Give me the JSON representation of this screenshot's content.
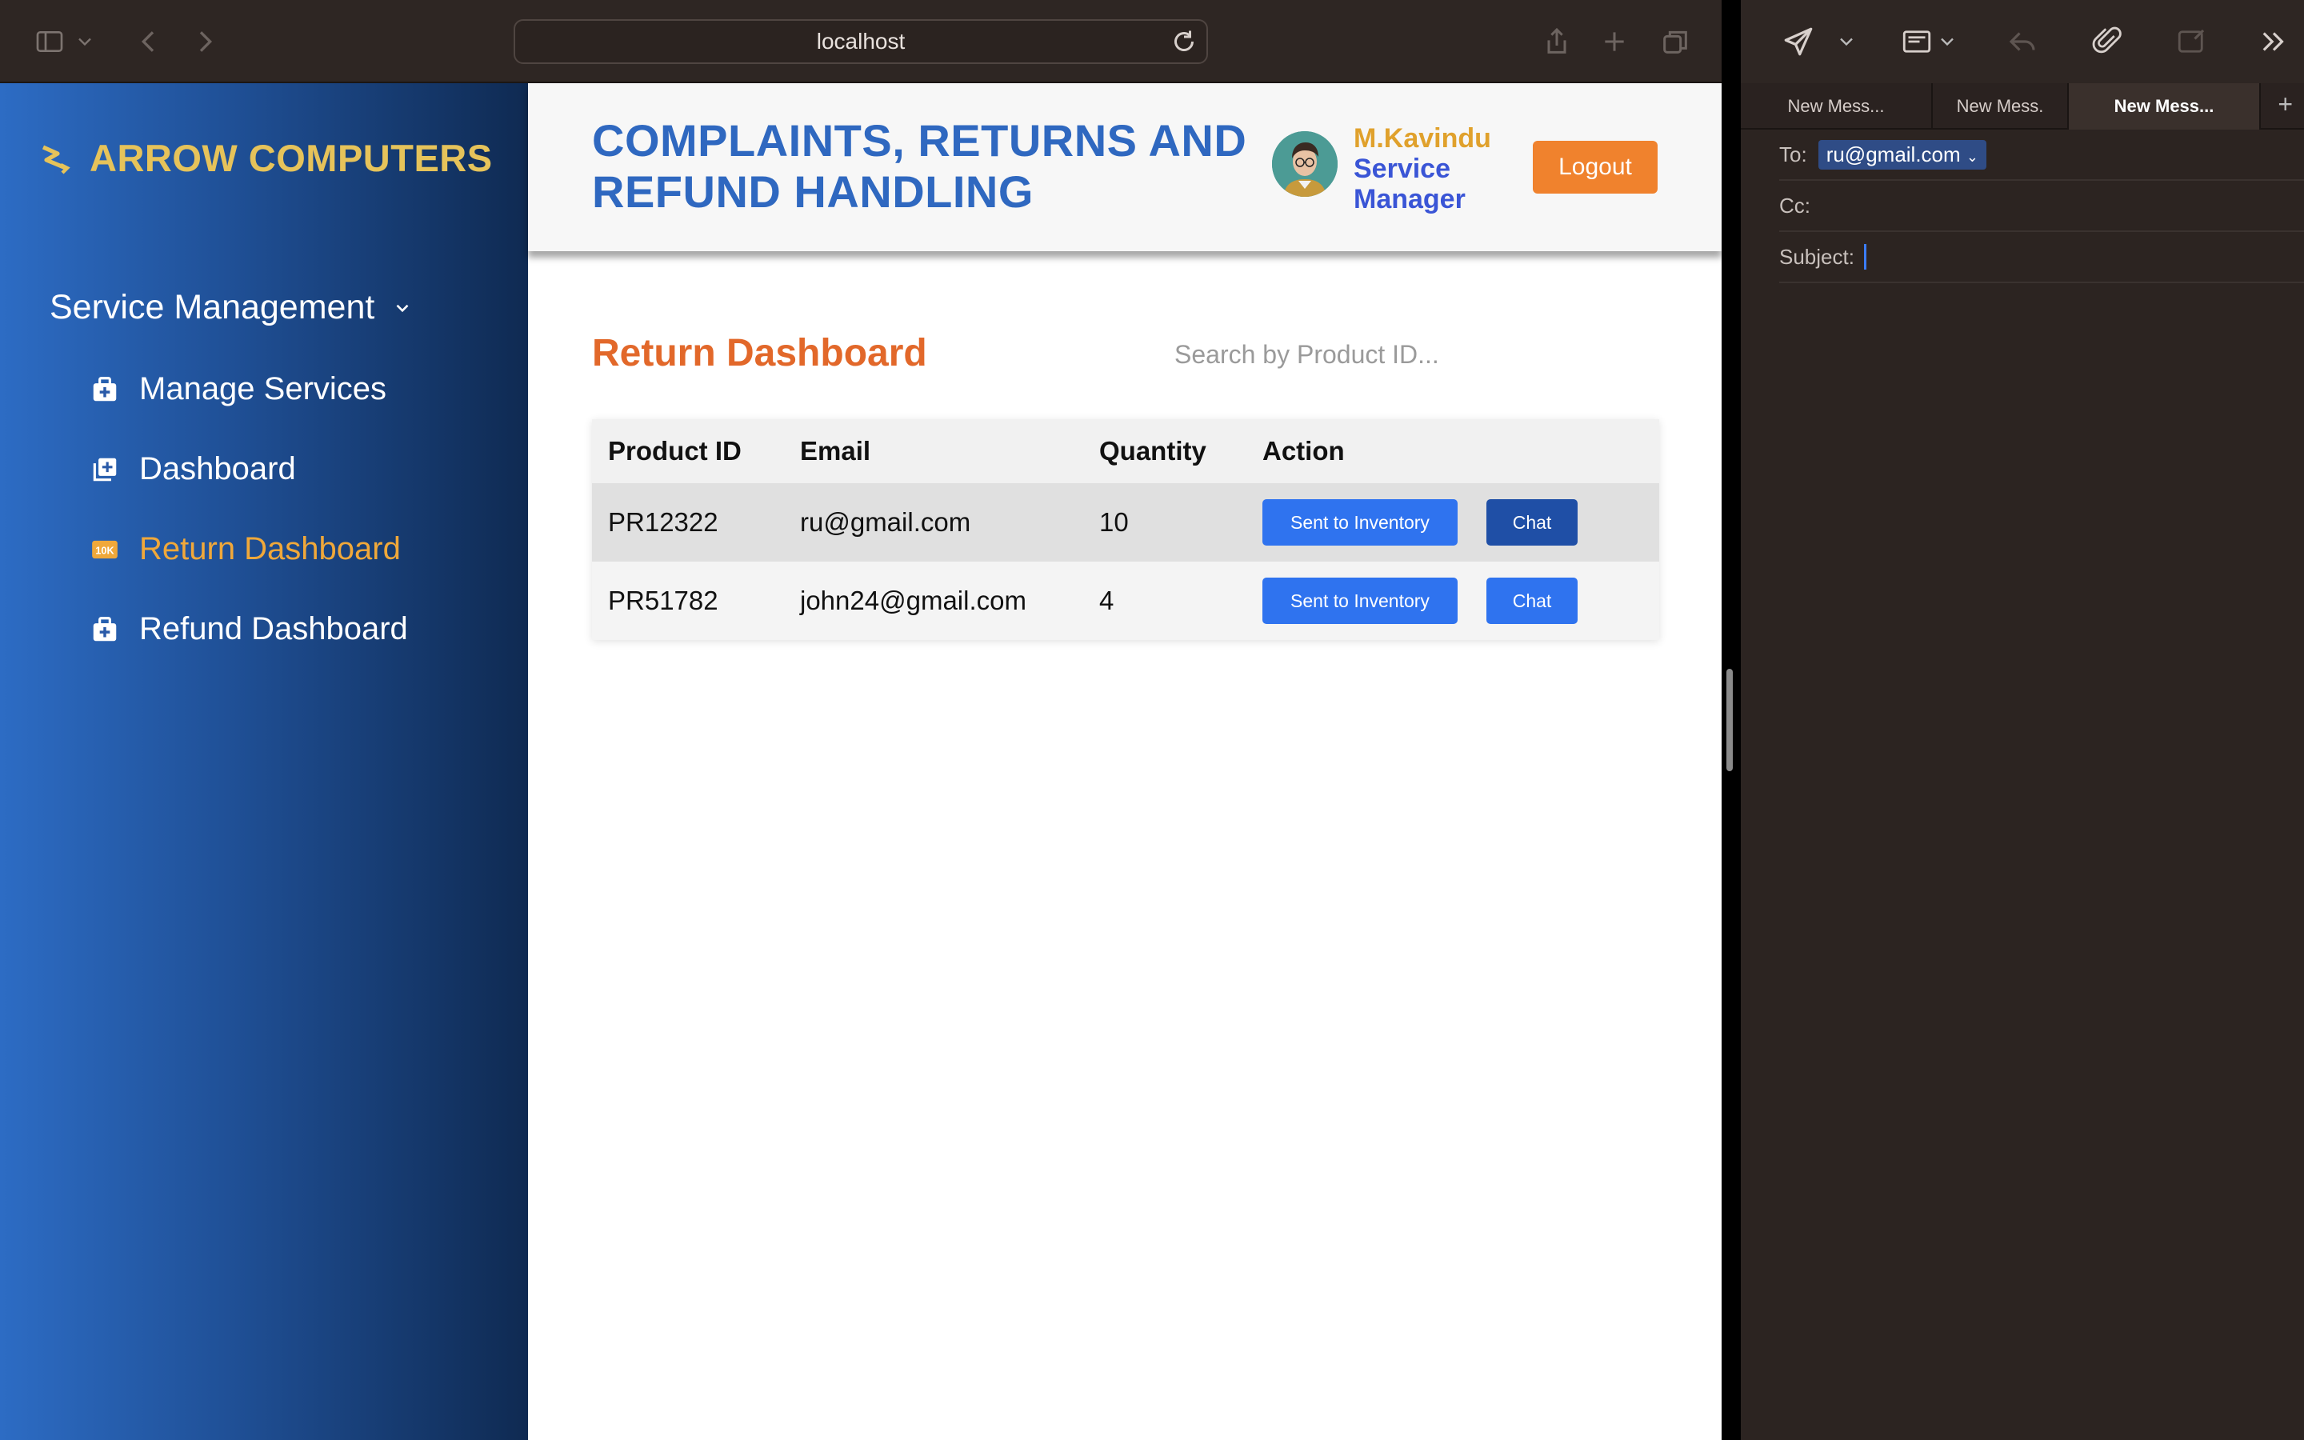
{
  "browser": {
    "url": "localhost"
  },
  "sidebar": {
    "brand": "ARROW COMPUTERS",
    "group_label": "Service Management",
    "items": [
      {
        "label": "Manage Services",
        "icon": "medkit-icon"
      },
      {
        "label": "Dashboard",
        "icon": "add-square-icon"
      },
      {
        "label": "Return Dashboard",
        "icon": "tag-icon",
        "active": true
      },
      {
        "label": "Refund Dashboard",
        "icon": "medkit-icon"
      }
    ]
  },
  "header": {
    "title": "COMPLAINTS, RETURNS AND REFUND HANDLING",
    "user_name": "M.Kavindu",
    "user_role": "Service Manager",
    "logout_label": "Logout"
  },
  "main": {
    "section_title": "Return Dashboard",
    "search_placeholder": "Search by Product ID...",
    "table": {
      "columns": [
        "Product ID",
        "Email",
        "Quantity",
        "Action"
      ],
      "rows": [
        {
          "product_id": "PR12322",
          "email": "ru@gmail.com",
          "quantity": "10",
          "inventory_label": "Sent to Inventory",
          "chat_label": "Chat"
        },
        {
          "product_id": "PR51782",
          "email": "john24@gmail.com",
          "quantity": "4",
          "inventory_label": "Sent to Inventory",
          "chat_label": "Chat"
        }
      ]
    }
  },
  "mail": {
    "tabs": [
      "New Mess...",
      "New Mess.",
      "New Mess..."
    ],
    "to_label": "To:",
    "to_value": "ru@gmail.com",
    "cc_label": "Cc:",
    "subject_label": "Subject:"
  },
  "colors": {
    "brand": "#e6c35a",
    "title": "#2f68c0",
    "accent_orange": "#f0822d",
    "button_blue": "#2f73ef",
    "active_nav": "#f0a83a"
  }
}
